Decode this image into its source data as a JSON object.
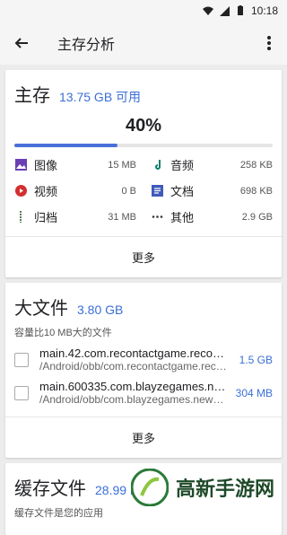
{
  "status_bar": {
    "time": "10:18"
  },
  "app_bar": {
    "title": "主存分析"
  },
  "storage_card": {
    "title": "主存",
    "available": "13.75 GB 可用",
    "percent": "40%",
    "used_fraction": 0.4,
    "categories": [
      {
        "label": "图像",
        "value": "15 MB",
        "color": "#6a3fb3",
        "icon": "image-icon"
      },
      {
        "label": "音频",
        "value": "258 KB",
        "color": "#0e7e6a",
        "icon": "music-note-icon"
      },
      {
        "label": "视频",
        "value": "0 B",
        "color": "#d32f2f",
        "icon": "play-icon"
      },
      {
        "label": "文档",
        "value": "698 KB",
        "color": "#3f5ab8",
        "icon": "document-icon"
      },
      {
        "label": "归档",
        "value": "31 MB",
        "color": "#5a7c5a",
        "icon": "zip-icon"
      },
      {
        "label": "其他",
        "value": "2.9 GB",
        "color": "#333333",
        "icon": "ellipsis-icon"
      }
    ],
    "more_label": "更多"
  },
  "large_files_card": {
    "title": "大文件",
    "size": "3.80 GB",
    "subtitle": "容量比10 MB大的文件",
    "files": [
      {
        "name": "main.42.com.recontactgame.recontactgame...",
        "path": "/Android/obb/com.recontactgame.recontactgame...",
        "size": "1.5 GB"
      },
      {
        "name": "main.600335.com.blayzegames.newfps...",
        "path": "/Android/obb/com.blayzegames.newfps...",
        "size": "304 MB"
      }
    ],
    "more_label": "更多"
  },
  "cache_card": {
    "title": "缓存文件",
    "size": "28.99 MB",
    "subtitle": "缓存文件是您的应用"
  },
  "watermark": {
    "text": "高新手游网"
  },
  "colors": {
    "accent": "#3b6fd6"
  }
}
